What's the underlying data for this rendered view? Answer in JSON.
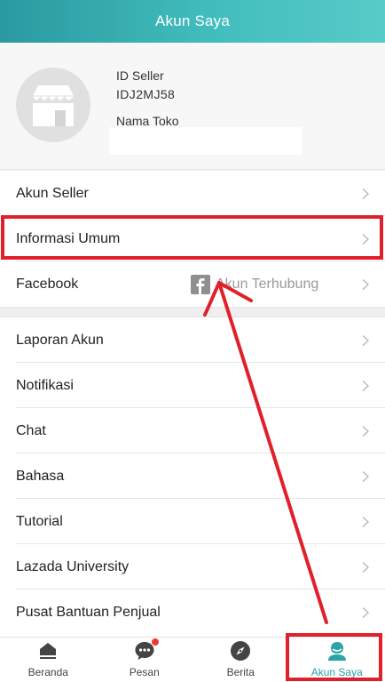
{
  "header": {
    "title": "Akun Saya"
  },
  "profile": {
    "id_label": "ID Seller",
    "id_value": "IDJ2MJ58",
    "store_label": "Nama Toko",
    "store_value": "",
    "avatar_icon": "store-icon"
  },
  "menu_group_1": [
    {
      "label": "Akun Seller"
    },
    {
      "label": "Informasi Umum"
    },
    {
      "label": "Facebook",
      "status_text": "Akun Terhubung",
      "status_icon": "facebook-icon"
    }
  ],
  "menu_group_2": [
    {
      "label": "Laporan Akun"
    },
    {
      "label": "Notifikasi"
    },
    {
      "label": "Chat"
    },
    {
      "label": "Bahasa"
    },
    {
      "label": "Tutorial"
    },
    {
      "label": "Lazada University"
    },
    {
      "label": "Pusat Bantuan Penjual"
    }
  ],
  "tabbar": {
    "tabs": [
      {
        "label": "Beranda",
        "icon": "home-icon",
        "active": false
      },
      {
        "label": "Pesan",
        "icon": "chat-bubble-icon",
        "active": false,
        "badge": true
      },
      {
        "label": "Berita",
        "icon": "compass-icon",
        "active": false
      },
      {
        "label": "Akun Saya",
        "icon": "user-icon",
        "active": true
      }
    ]
  },
  "colors": {
    "header_start": "#2a9aa0",
    "header_end": "#57cbc8",
    "accent": "#2aa3a9",
    "annotation_red": "#e0202a",
    "badge": "#f03a3a"
  }
}
